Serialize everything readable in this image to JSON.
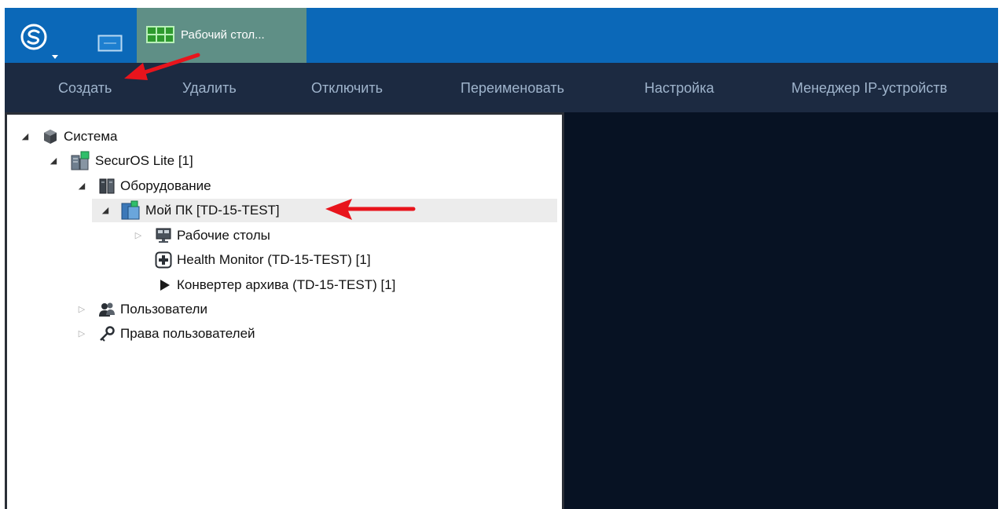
{
  "header": {
    "desktop_tab_label": "Рабочий стол..."
  },
  "toolbar": {
    "buttons": [
      "Создать",
      "Удалить",
      "Отключить",
      "Переименовать",
      "Настройка",
      "Менеджер IP-устройств"
    ]
  },
  "tree": {
    "items": [
      {
        "label": "Система",
        "icon": "system-cube-icon",
        "expanded": true
      },
      {
        "label": "SecurOS Lite [1]",
        "icon": "securos-server-icon",
        "expanded": true
      },
      {
        "label": "Оборудование",
        "icon": "hardware-icon",
        "expanded": true
      },
      {
        "label": "Мой ПК [TD-15-TEST]",
        "icon": "computer-icon",
        "expanded": true,
        "selected": true
      },
      {
        "label": "Рабочие столы",
        "icon": "desktops-icon",
        "expanded": false
      },
      {
        "label": "Health Monitor (TD-15-TEST) [1]",
        "icon": "health-monitor-icon"
      },
      {
        "label": "Конвертер архива (TD-15-TEST) [1]",
        "icon": "play-triangle-icon"
      },
      {
        "label": "Пользователи",
        "icon": "users-icon",
        "expanded": false
      },
      {
        "label": "Права пользователей",
        "icon": "key-icon",
        "expanded": false
      }
    ]
  },
  "colors": {
    "topbar": "#0b68b8",
    "active_tab": "#5f8f86",
    "toolbar": "#1c2a41",
    "toolbar_text": "#9fb4cc",
    "viewer": "#071223",
    "annotation_arrow": "#e8141c"
  }
}
